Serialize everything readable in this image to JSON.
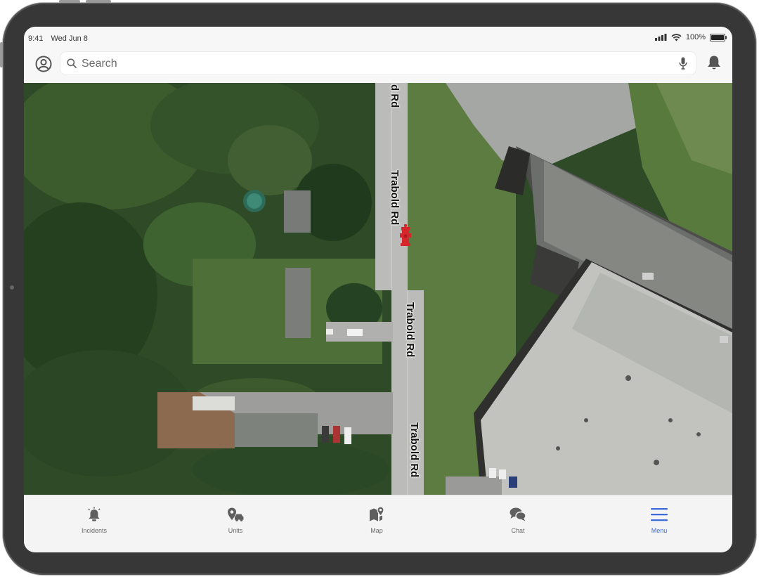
{
  "status_bar": {
    "time": "9:41",
    "date": "Wed Jun 8",
    "battery": "100%"
  },
  "search": {
    "placeholder": "Search",
    "value": ""
  },
  "map": {
    "road_labels": [
      "Trabold Rd",
      "Trabold Rd",
      "Trabold Rd",
      "d Rd"
    ],
    "hydrant_color": "#d7262b"
  },
  "tabs": [
    {
      "label": "Incidents",
      "icon": "alarm-bell-icon"
    },
    {
      "label": "Units",
      "icon": "units-map-pin-icon"
    },
    {
      "label": "Map",
      "icon": "map-icon"
    },
    {
      "label": "Chat",
      "icon": "chat-bubbles-icon"
    },
    {
      "label": "Menu",
      "icon": "hamburger-menu-icon"
    }
  ],
  "active_tab": "Menu",
  "colors": {
    "accent": "#3a6bd8",
    "device_frame": "#373737"
  }
}
